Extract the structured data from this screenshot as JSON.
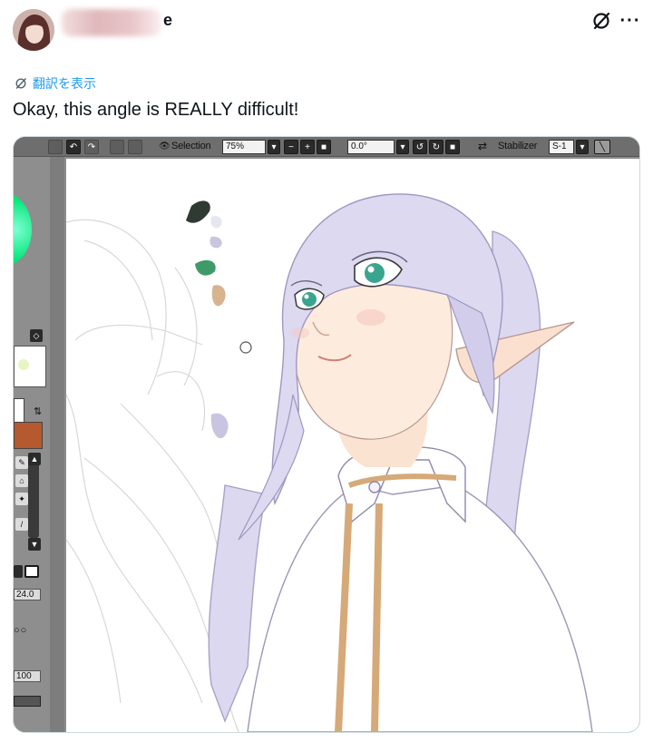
{
  "post": {
    "author_visible": "e",
    "translate_label": "翻訳を表示",
    "text": "Okay, this angle is REALLY difficult!"
  },
  "app": {
    "toolbar": {
      "selection_label": "Selection",
      "zoom_value": "75%",
      "rotation_value": "0.0°",
      "stabilizer_label": "Stabilizer",
      "stabilizer_value": "S-1"
    },
    "left_panel": {
      "brush_size": "24.0",
      "density": "100"
    }
  },
  "colors": {
    "hair": "#d9d4ef",
    "skin": "#fbe9dc",
    "eyes": "#3aa58e",
    "trim": "#d6a978",
    "link": "#1d9bf0"
  }
}
